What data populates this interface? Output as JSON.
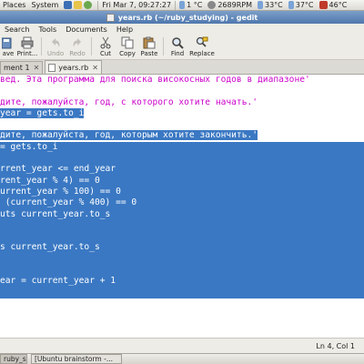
{
  "top_panel": {
    "places": "Places",
    "system": "System",
    "clock": "Fri Mar  7, 09:27:27",
    "temp1": "1 °C",
    "fan": "2689RPM",
    "temp2": "33°C",
    "temp3": "37°C",
    "temp4": "46°C"
  },
  "window": {
    "title": "years.rb (~/ruby_studying) - gedit"
  },
  "menu": {
    "search": "Search",
    "tools": "Tools",
    "documents": "Documents",
    "help": "Help"
  },
  "toolbar": {
    "save": "ave",
    "print": "Print...",
    "undo": "Undo",
    "redo": "Redo",
    "cut": "Cut",
    "copy": "Copy",
    "paste": "Paste",
    "find": "Find",
    "replace": "Replace"
  },
  "tabs": {
    "tab1": "ment 1",
    "tab2": "years.rb",
    "close": "✕"
  },
  "editor": {
    "lines": [
      "вед. Эта программа для поиска високосных годов в диапазоне'",
      "",
      "дите, пожалуйста, год, с которого хотите начать.'",
      "year = gets.to_i",
      "",
      "дите, пожалуйста, год, которым хотите закончить.'",
      "= gets.to_i",
      "",
      "rrent_year <= end_year",
      "rent_year % 4) == 0",
      "urrent_year % 100) == 0",
      " (current_year % 400) == 0",
      "uts current_year.to_s",
      "",
      "",
      "s current_year.to_s",
      "",
      "",
      "ear = current_year + 1",
      ""
    ]
  },
  "status": {
    "position": "Ln 4, Col 1"
  },
  "taskbar": {
    "task1": "ruby_stu...",
    "task2": "[Ubuntu brainstorm -..."
  }
}
